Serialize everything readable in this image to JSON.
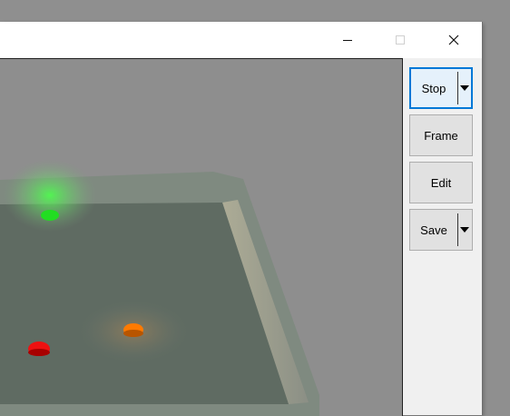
{
  "window": {
    "controls": {
      "minimize_glyph": "—",
      "close_glyph": "✕"
    }
  },
  "sidebar": {
    "buttons": [
      {
        "id": "stop",
        "label": "Stop",
        "has_dropdown": true,
        "state": "focused"
      },
      {
        "id": "frame",
        "label": "Frame",
        "has_dropdown": false
      },
      {
        "id": "edit",
        "label": "Edit",
        "has_dropdown": false
      },
      {
        "id": "save",
        "label": "Save",
        "has_dropdown": true
      }
    ]
  },
  "scene": {
    "background_color": "#8e8e8e",
    "markers": [
      {
        "name": "green-marker",
        "color": "#22dd22"
      },
      {
        "name": "orange-marker",
        "color": "#ff7a00"
      },
      {
        "name": "red-marker",
        "color": "#ee1111"
      }
    ]
  },
  "colors": {
    "accent": "#0078d7",
    "button_face": "#e1e1e1"
  }
}
